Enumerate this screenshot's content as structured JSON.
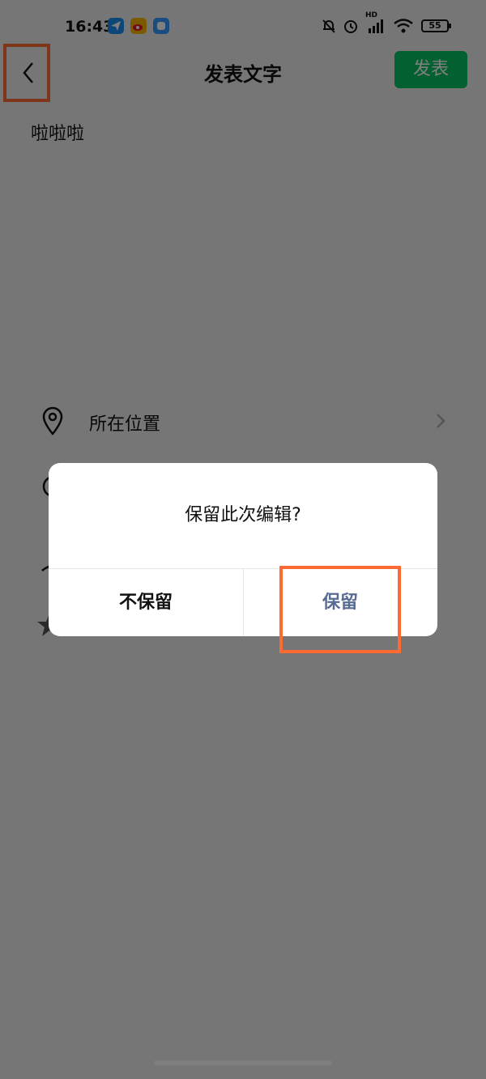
{
  "status_bar": {
    "time": "16:43",
    "hd": "HD",
    "battery": "55",
    "app_icons": [
      "paper-plane-app-icon",
      "weibo-app-icon",
      "chat-app-icon"
    ],
    "right_icons": [
      "mute-bell-icon",
      "alarm-icon",
      "signal-icon",
      "wifi-icon",
      "battery-icon"
    ]
  },
  "nav": {
    "title": "发表文字",
    "publish_label": "发表"
  },
  "content": {
    "text": "啦啦啦"
  },
  "options": {
    "location_label": "所在位置"
  },
  "dialog": {
    "title": "保留此次编辑?",
    "discard_label": "不保留",
    "keep_label": "保留"
  },
  "colors": {
    "accent_green": "#07c160",
    "link_blue": "#576b95",
    "highlight_orange": "#ff6a33"
  }
}
